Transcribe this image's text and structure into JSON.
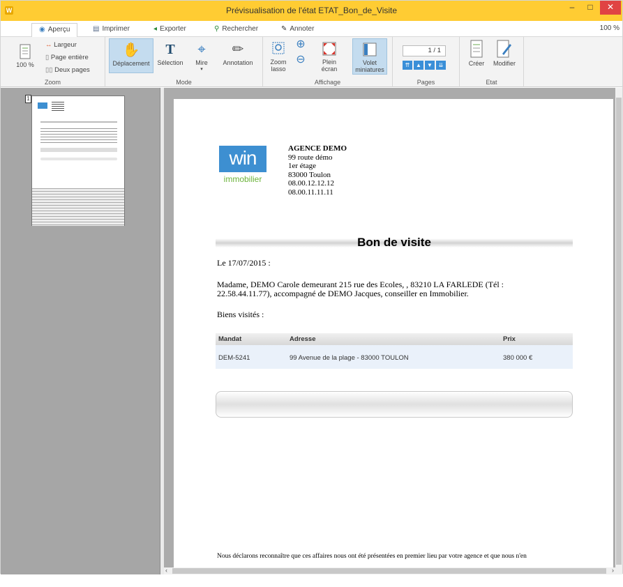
{
  "window": {
    "title": "Prévisualisation de l'état ETAT_Bon_de_Visite",
    "app_icon": "W",
    "minimize": "–",
    "maximize": "□",
    "close": "✕"
  },
  "tabs": [
    {
      "label": "Aperçu",
      "icon": "eye-icon"
    },
    {
      "label": "Imprimer",
      "icon": "printer-icon"
    },
    {
      "label": "Exporter",
      "icon": "export-icon"
    },
    {
      "label": "Rechercher",
      "icon": "search-icon"
    },
    {
      "label": "Annoter",
      "icon": "pen-icon"
    }
  ],
  "zoom_level_text": "100 %",
  "ribbon": {
    "zoom": {
      "group_label": "Zoom",
      "percent_label": "100 %",
      "largeur": "Largeur",
      "page_entiere": "Page entière",
      "deux_pages": "Deux pages"
    },
    "mode": {
      "group_label": "Mode",
      "deplacement": "Déplacement",
      "selection": "Sélection",
      "mire": "Mire",
      "annotation": "Annotation"
    },
    "affichage": {
      "group_label": "Affichage",
      "zoom_lasso_1": "Zoom",
      "zoom_lasso_2": "lasso",
      "plein_1": "Plein",
      "plein_2": "écran",
      "volet_1": "Volet",
      "volet_2": "miniatures"
    },
    "pages": {
      "group_label": "Pages",
      "page_indicator": "1 / 1"
    },
    "etat": {
      "group_label": "Etat",
      "creer": "Créer",
      "modifier": "Modifier"
    }
  },
  "thumbnail": {
    "page_number": "1"
  },
  "document": {
    "logo_main": "win",
    "logo_sub": "immobilier",
    "agency": {
      "name": "AGENCE DEMO",
      "line1": "99 route démo",
      "line2": "1er étage",
      "line3": "83000 Toulon",
      "phone1": "08.00.12.12.12",
      "phone2": "08.00.11.11.11"
    },
    "heading": "Bon de visite",
    "date_line": "Le 17/07/2015 :",
    "paragraph": "Madame, DEMO Carole demeurant 215 rue des Ecoles, , 83210 LA FARLEDE  (Tél : 22.58.44.11.77), accompagné de DEMO Jacques, conseiller en Immobilier.",
    "biens_label": "Biens visités :",
    "table": {
      "headers": {
        "mandat": "Mandat",
        "adresse": "Adresse",
        "prix": "Prix"
      },
      "row": {
        "mandat": "DEM-5241",
        "adresse": "99 Avenue de la plage - 83000 TOULON",
        "prix": "380 000 €"
      }
    },
    "footer_text": "Nous déclarons reconnaître que ces affaires nous ont été présentées en premier lieu par votre agence et que nous n'en"
  },
  "colors": {
    "titlebar": "#ffcc33",
    "close": "#e04343",
    "selected_button": "#c4dcef",
    "logo_blue": "#3d8fd1",
    "logo_green": "#6bb33a"
  }
}
